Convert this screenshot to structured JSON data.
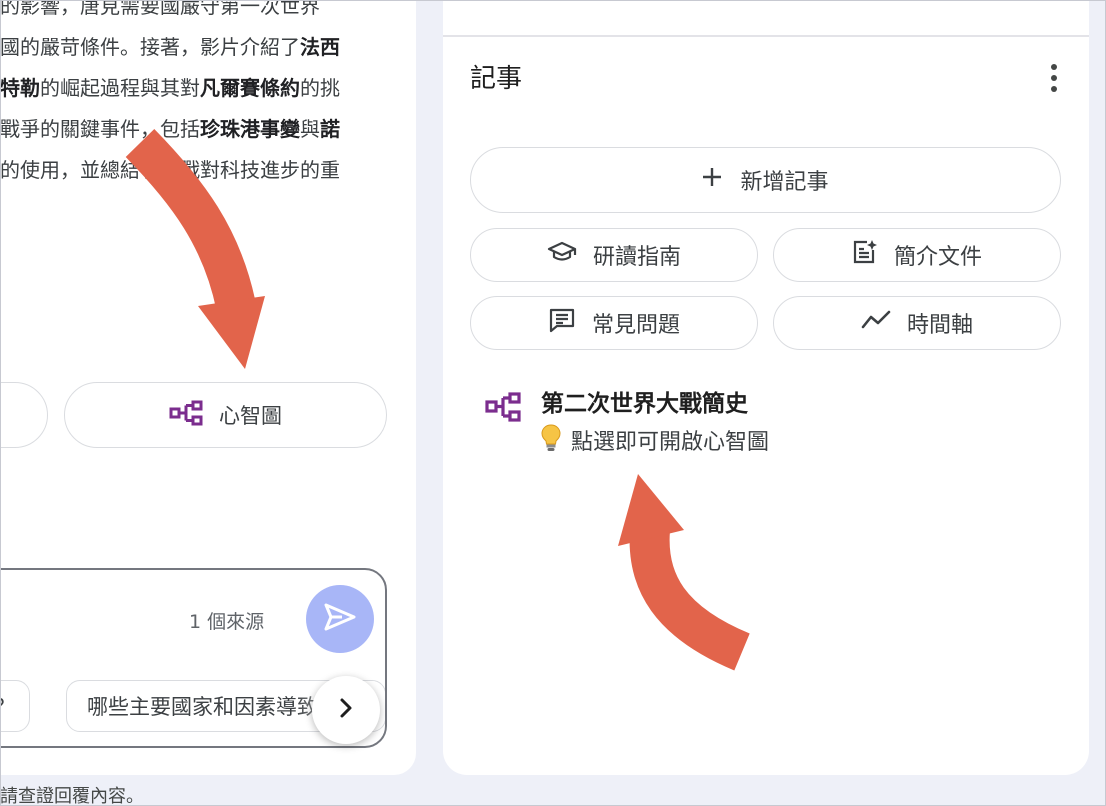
{
  "summary": {
    "line0": "的影響，唐見需要國嚴守第一次世界",
    "line1_a": "國的嚴苛條件。接著，影片介紹了",
    "line1_b": "法西",
    "line2_a": "特勒",
    "line2_b": "的崛起過程與其對",
    "line2_c": "凡爾賽條約",
    "line2_d": "的挑",
    "line3_a": "戰爭的關鍵事件，包括",
    "line3_b": "珍珠港事變",
    "line3_c": "與",
    "line3_d": "諾",
    "line4": "的使用，並總結了二戰對科技進步的重"
  },
  "left_actions": {
    "mindmap_label": "心智圖"
  },
  "chat": {
    "source_count": "1 個來源",
    "suggestion_partial": "么？",
    "suggestion_2": "哪些主要國家和因素導致"
  },
  "footer_note": "請查證回覆內容。",
  "notes_panel": {
    "title": "記事",
    "add_note_label": "新增記事",
    "tools": {
      "study_guide": "研讀指南",
      "briefing_doc": "簡介文件",
      "faq": "常見問題",
      "timeline": "時間軸"
    },
    "note": {
      "title": "第二次世界大戰簡史",
      "hint": "點選即可開啟心智圖"
    }
  },
  "colors": {
    "mindmap_icon": "#7b2d8e",
    "send_button": "#a8b6f7",
    "annotation_arrow": "#e2644b",
    "background": "#eef0f8"
  },
  "icons": {
    "mindmap": "mindmap-icon",
    "send": "send-icon",
    "next": "chevron-right-icon",
    "add": "plus-icon",
    "study_guide": "graduation-cap-icon",
    "briefing_doc": "document-sparkle-icon",
    "faq": "chat-lines-icon",
    "timeline": "trend-line-icon",
    "more": "more-vert-icon",
    "bulb": "light-bulb-icon"
  }
}
